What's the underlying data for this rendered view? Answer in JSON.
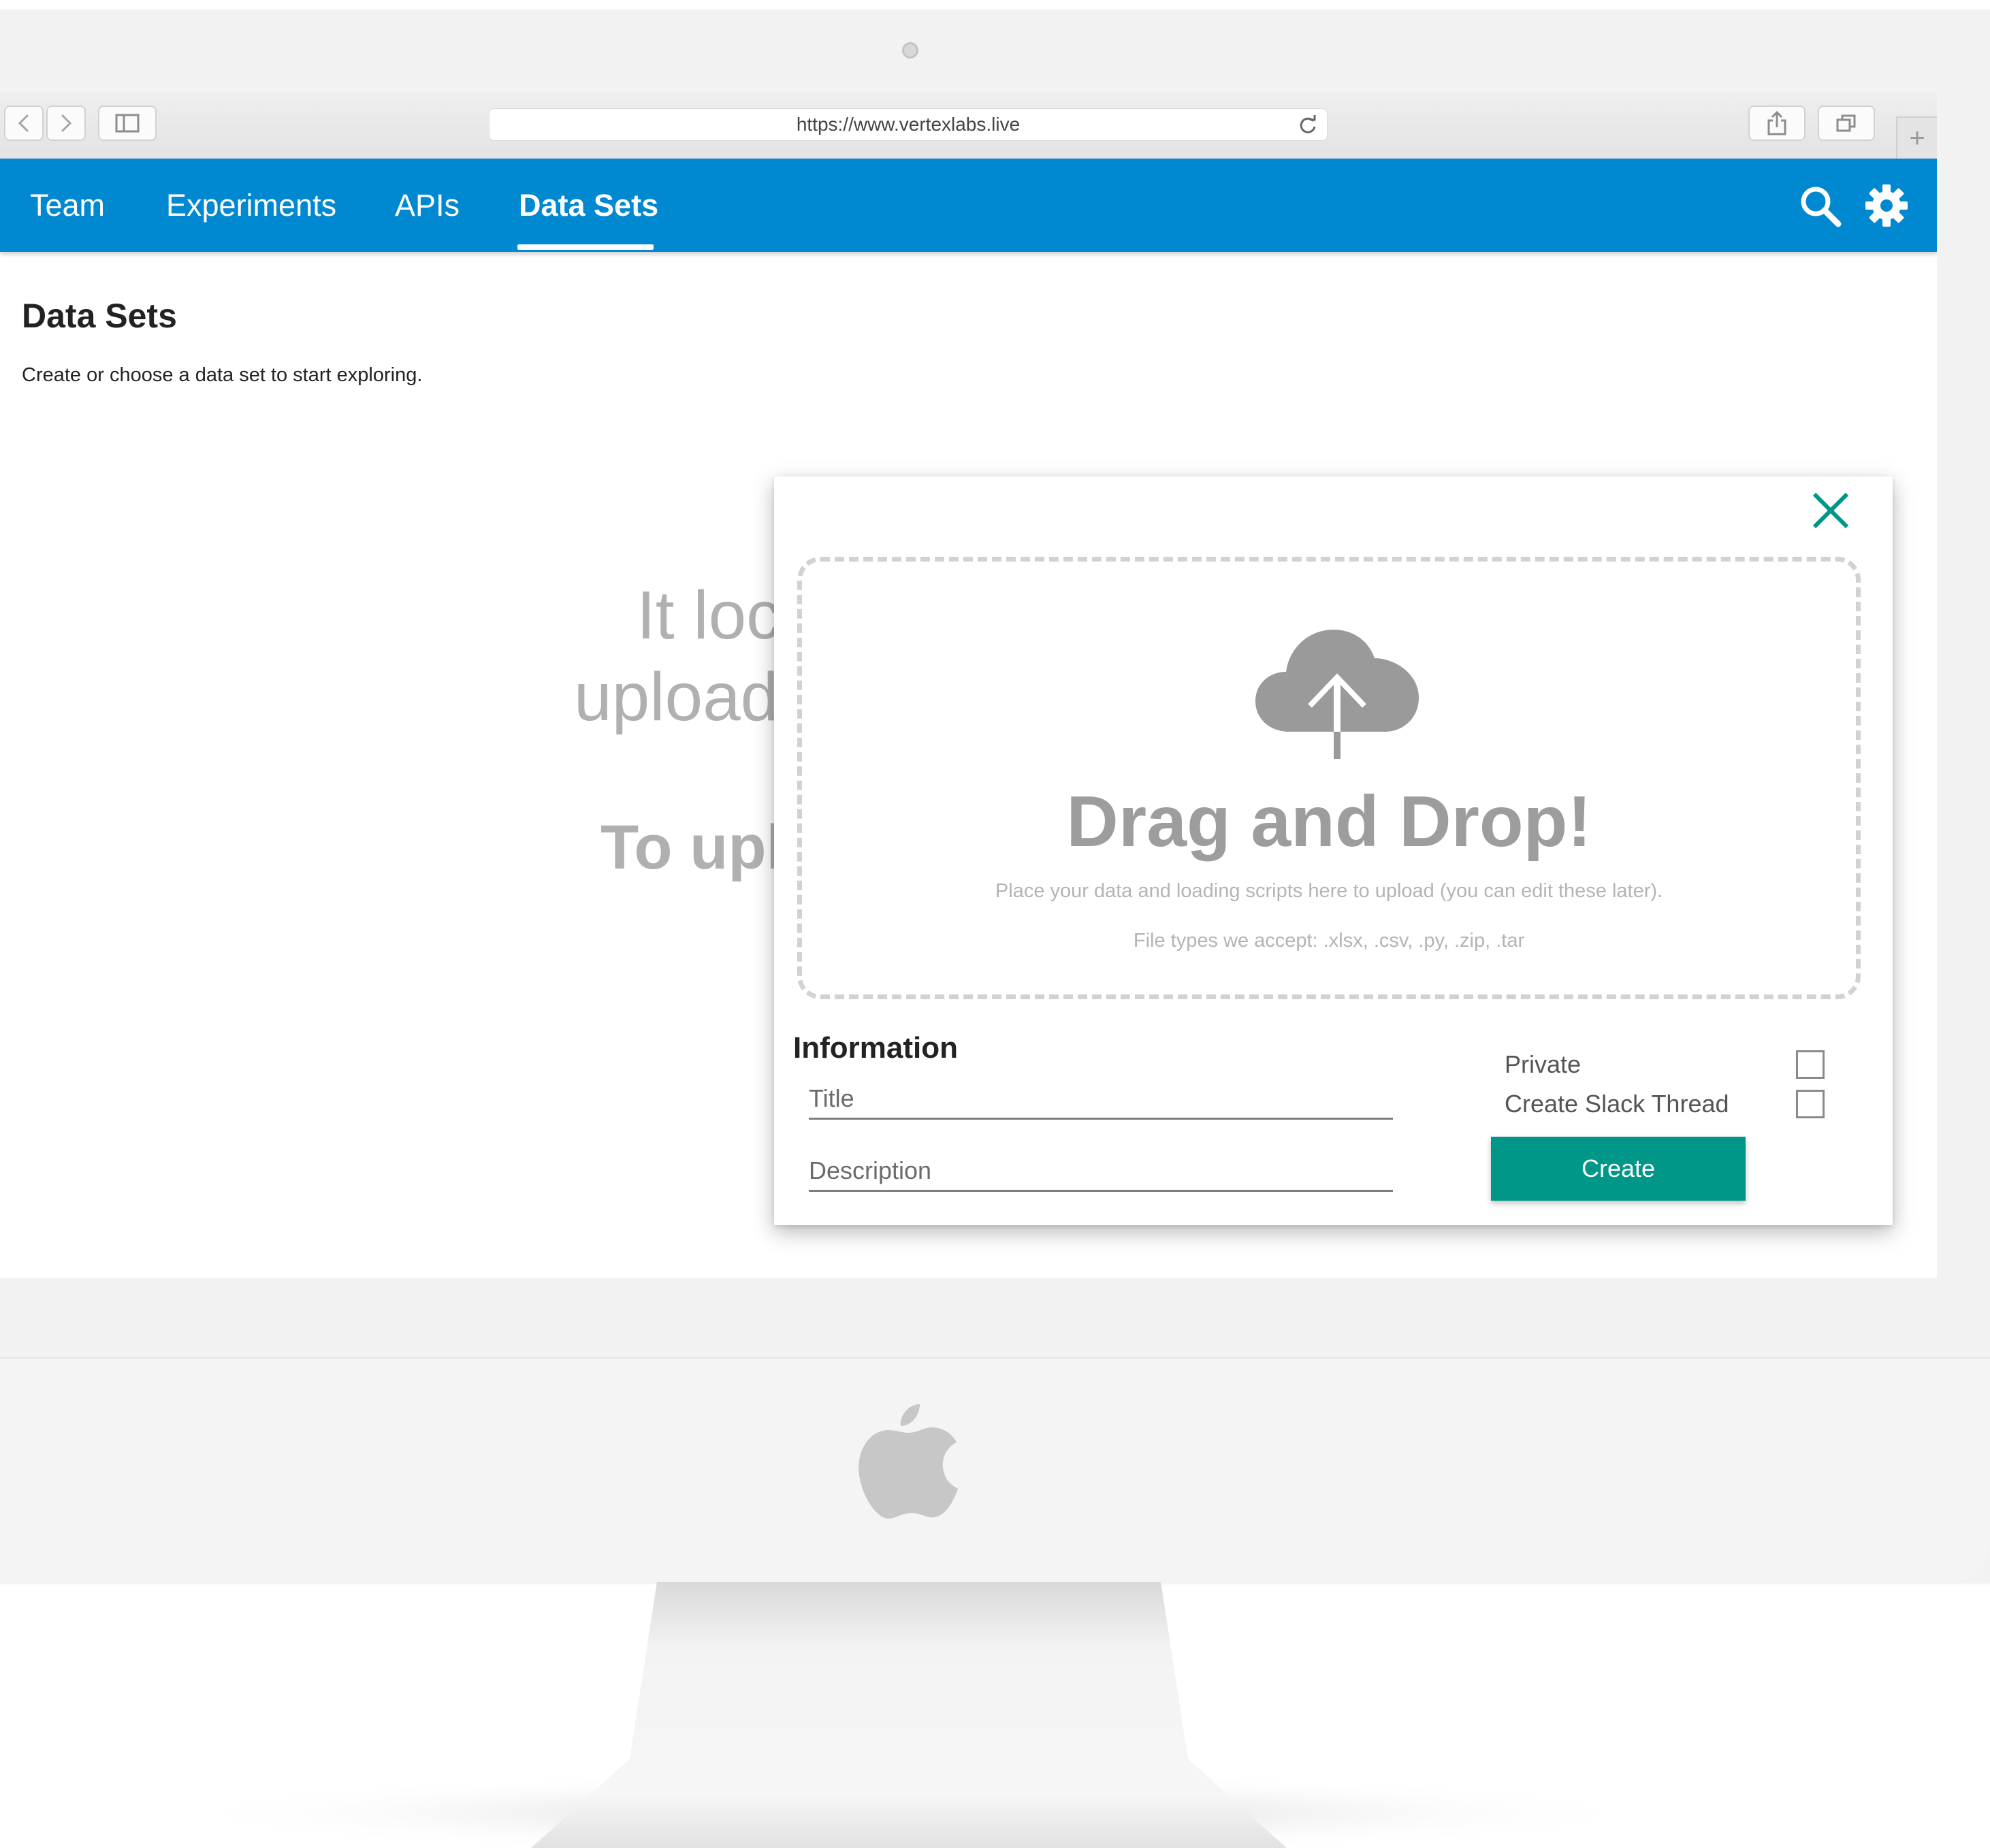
{
  "browser": {
    "url": "https://www.vertexlabs.live",
    "new_tab_glyph": "+"
  },
  "nav": {
    "tabs": [
      {
        "label": "Team"
      },
      {
        "label": "Experiments"
      },
      {
        "label": "APIs"
      },
      {
        "label": "Data Sets",
        "active": true
      }
    ],
    "accent_color": "#0088d1"
  },
  "page": {
    "title": "Data Sets",
    "subtitle": "Create or choose a data set to start exploring.",
    "empty_state": {
      "line1": "It loc",
      "line2": "upload",
      "line3": "To upl"
    }
  },
  "modal": {
    "dropzone": {
      "heading": "Drag and Drop!",
      "hint": "Place your data and loading scripts here to upload (you can edit these later).",
      "file_types": "File types we accept:  .xlsx, .csv, .py, .zip, .tar"
    },
    "info": {
      "heading": "Information",
      "title_placeholder": "Title",
      "description_placeholder": "Description",
      "private_label": "Private",
      "slack_label": "Create Slack Thread",
      "private_checked": false,
      "slack_checked": false,
      "create_label": "Create"
    },
    "accent_color": "#009688"
  },
  "icons": [
    "back-icon",
    "forward-icon",
    "sidebar-icon",
    "reload-icon",
    "share-icon",
    "tabs-icon",
    "search-icon",
    "gear-icon",
    "close-icon",
    "cloud-upload-icon",
    "apple-logo"
  ]
}
